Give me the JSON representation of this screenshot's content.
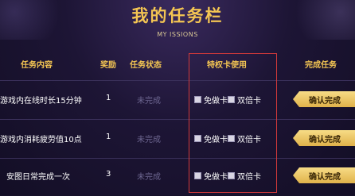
{
  "header": {
    "title": "我的任务栏",
    "subtitle": "MY ISSIONS"
  },
  "columns": {
    "task": "任务内容",
    "reward": "奖励",
    "status": "任务状态",
    "card": "特权卡使用",
    "complete": "完成任务"
  },
  "rows": [
    {
      "task": "游戏内在线时长15分钟",
      "reward": "1",
      "status": "未完成",
      "card_free": "免做卡",
      "card_double": "双倍卡",
      "button": "确认完成"
    },
    {
      "task": "游戏内消耗疲劳值10点",
      "reward": "1",
      "status": "未完成",
      "card_free": "免做卡",
      "card_double": "双倍卡",
      "button": "确认完成"
    },
    {
      "task": "安图日常完成一次",
      "reward": "3",
      "status": "未完成",
      "card_free": "免做卡",
      "card_double": "双倍卡",
      "button": "确认完成"
    }
  ],
  "colors": {
    "gold": "#f3c553",
    "highlight_border": "#d0393a",
    "background": "#16112a"
  }
}
